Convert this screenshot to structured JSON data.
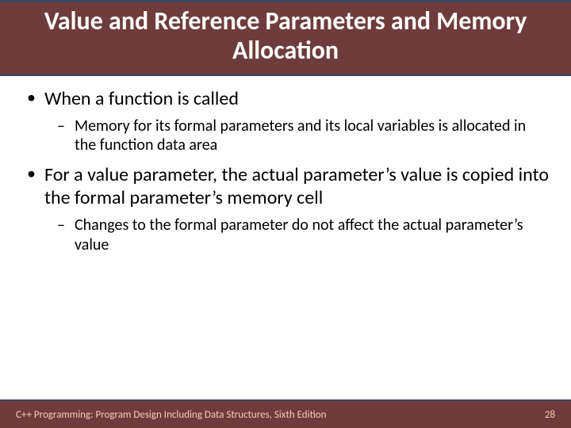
{
  "title": "Value and Reference Parameters and Memory Allocation",
  "bullets": [
    {
      "text": "When a function is called",
      "sub": [
        "Memory for its formal parameters and its local variables is allocated in the function data area"
      ]
    },
    {
      "text": "For a value parameter, the actual parameter’s value is copied into the formal parameter’s memory cell",
      "sub": [
        "Changes to the formal parameter do not affect the actual parameter’s value"
      ]
    }
  ],
  "footer": {
    "left": "C++ Programming: Program Design Including Data Structures, Sixth Edition",
    "right": "28"
  }
}
